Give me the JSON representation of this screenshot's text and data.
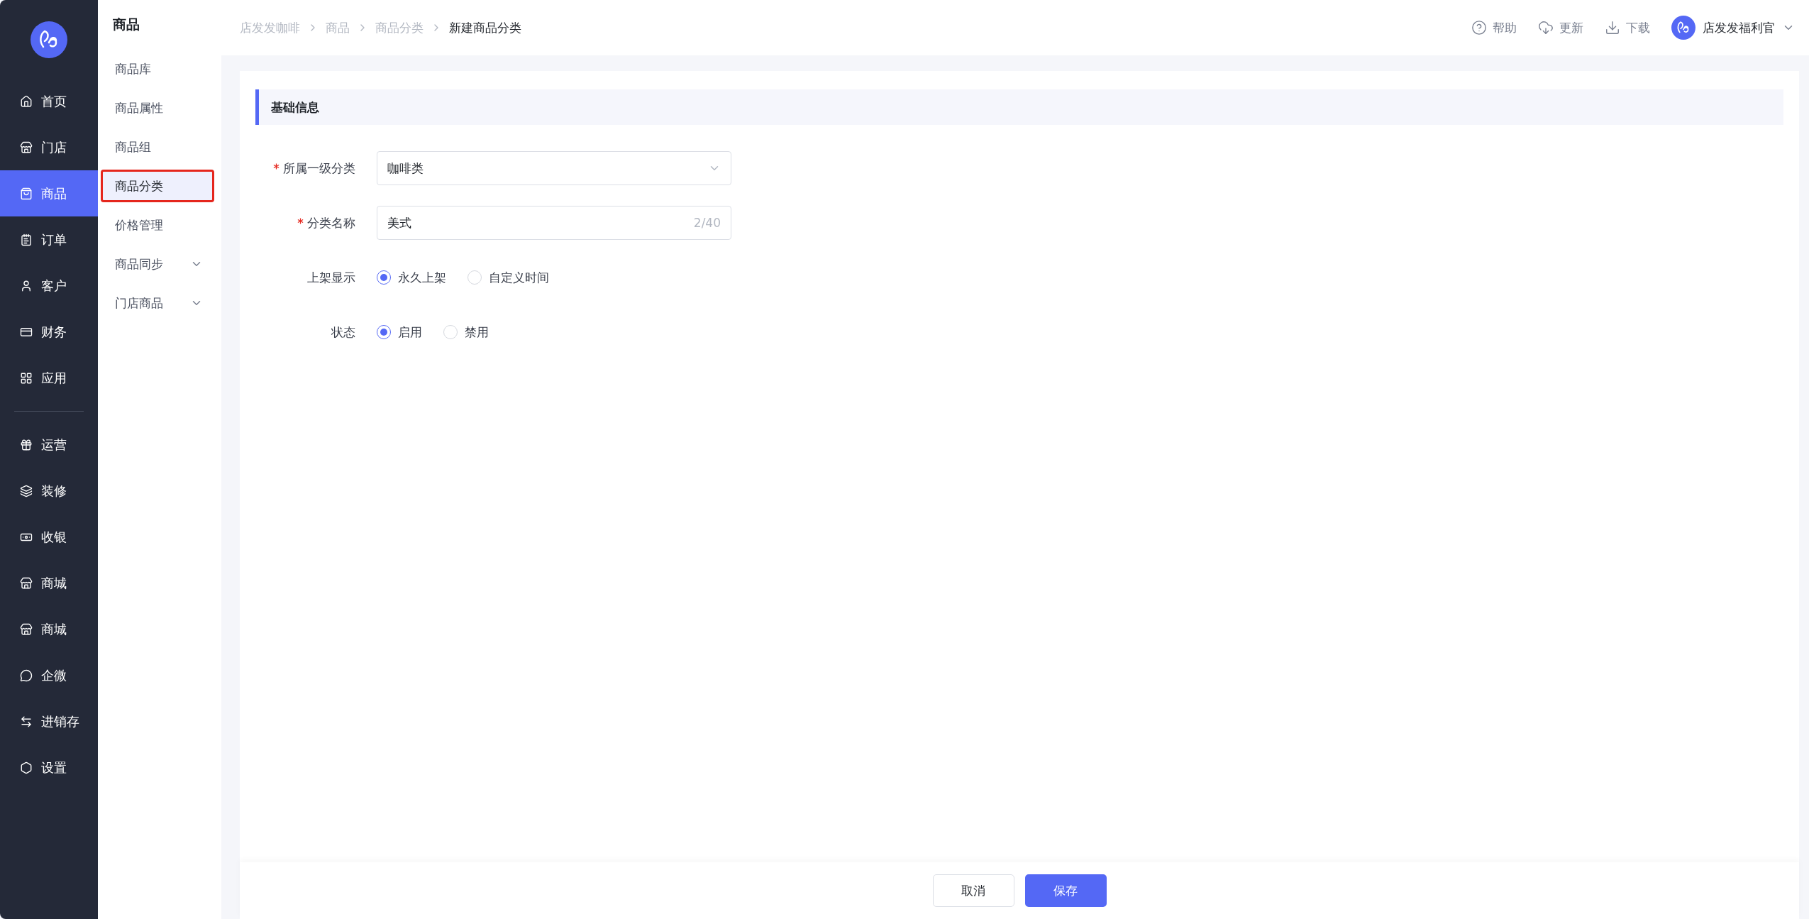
{
  "main_nav": {
    "items": [
      {
        "label": "首页",
        "selected": false
      },
      {
        "label": "门店",
        "selected": false
      },
      {
        "label": "商品",
        "selected": true
      },
      {
        "label": "订单",
        "selected": false
      },
      {
        "label": "客户",
        "selected": false
      },
      {
        "label": "财务",
        "selected": false
      },
      {
        "label": "应用",
        "selected": false
      },
      {
        "label": "运营",
        "selected": false
      },
      {
        "label": "装修",
        "selected": false
      },
      {
        "label": "收银",
        "selected": false
      },
      {
        "label": "商城",
        "selected": false
      },
      {
        "label": "商城",
        "selected": false
      },
      {
        "label": "企微",
        "selected": false
      },
      {
        "label": "进销存",
        "selected": false
      },
      {
        "label": "设置",
        "selected": false
      }
    ]
  },
  "sub_nav": {
    "title": "商品",
    "items": [
      {
        "label": "商品库",
        "selected": false,
        "expandable": false
      },
      {
        "label": "商品属性",
        "selected": false,
        "expandable": false
      },
      {
        "label": "商品组",
        "selected": false,
        "expandable": false
      },
      {
        "label": "商品分类",
        "selected": true,
        "expandable": false
      },
      {
        "label": "价格管理",
        "selected": false,
        "expandable": false
      },
      {
        "label": "商品同步",
        "selected": false,
        "expandable": true
      },
      {
        "label": "门店商品",
        "selected": false,
        "expandable": true
      }
    ]
  },
  "breadcrumb": [
    "店发发咖啡",
    "商品",
    "商品分类",
    "新建商品分类"
  ],
  "header_actions": [
    {
      "label": "帮助"
    },
    {
      "label": "更新"
    },
    {
      "label": "下载"
    }
  ],
  "user": {
    "name": "店发发福利官"
  },
  "section": {
    "title": "基础信息"
  },
  "form": [
    {
      "kind": "select",
      "label": "所属一级分类",
      "required": true,
      "value": "咖啡类"
    },
    {
      "kind": "text",
      "label": "分类名称",
      "required": true,
      "value": "美式",
      "counter": "2/40"
    },
    {
      "kind": "radio",
      "label": "上架显示",
      "required": false,
      "options": [
        {
          "label": "永久上架",
          "selected": true
        },
        {
          "label": "自定义时间",
          "selected": false
        }
      ]
    },
    {
      "kind": "radio",
      "label": "状态",
      "required": false,
      "options": [
        {
          "label": "启用",
          "selected": true
        },
        {
          "label": "禁用",
          "selected": false
        }
      ]
    }
  ],
  "footer": {
    "buttons": [
      {
        "label": "取消",
        "kind": "secondary"
      },
      {
        "label": "保存",
        "kind": "primary"
      }
    ]
  }
}
